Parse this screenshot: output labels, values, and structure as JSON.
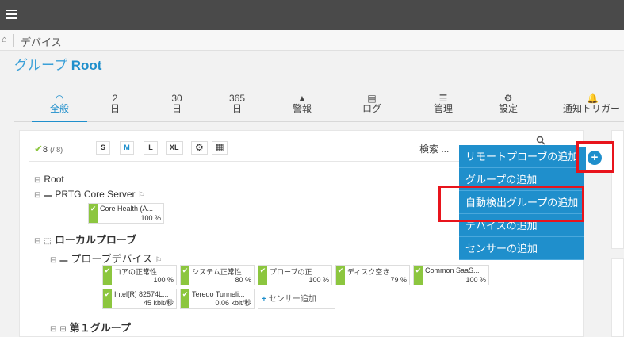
{
  "breadcrumb": {
    "item": "デバイス"
  },
  "title": {
    "prefix": "グループ",
    "name": "Root"
  },
  "tabs": [
    {
      "icon": "◠",
      "label": "全般"
    },
    {
      "icon": "2",
      "label": "日"
    },
    {
      "icon": "30",
      "label": "日"
    },
    {
      "icon": "365",
      "label": "日"
    },
    {
      "icon": "▲",
      "label": "警報"
    },
    {
      "icon": "▤",
      "label": "ログ"
    },
    {
      "icon": "☰",
      "label": "管理"
    },
    {
      "icon": "⚙",
      "label": "設定"
    },
    {
      "icon": "🔔",
      "label": "通知トリガー"
    }
  ],
  "toolbar": {
    "count": "8",
    "count_total": "(/ 8)",
    "sizes": [
      "S",
      "M",
      "L",
      "XL"
    ],
    "search_label": "検索 ..."
  },
  "tree": {
    "root": "Root",
    "core_server": "PRTG Core Server",
    "local_probe": "ローカルプローブ",
    "probe_device": "プローブデバイス",
    "group1": "第１グループ"
  },
  "sensors_core": [
    {
      "name": "Core Health (A...",
      "value": "100 %"
    }
  ],
  "sensors_probe": [
    {
      "name": "コアの正常性",
      "value": "100 %"
    },
    {
      "name": "システム正常性",
      "value": "80 %"
    },
    {
      "name": "プローブの正...",
      "value": "100 %"
    },
    {
      "name": "ディスク空き...",
      "value": "79 %"
    },
    {
      "name": "Common SaaS...",
      "value": "100 %"
    },
    {
      "name": "Intel[R] 82574L...",
      "value": "45 kbit/秒"
    },
    {
      "name": "Teredo Tunneli...",
      "value": "0.06 kbit/秒"
    }
  ],
  "add_sensor_label": "センサー追加",
  "menu": [
    "リモートプローブの追加",
    "グループの追加",
    "自動検出グループの追加",
    "デバイスの追加",
    "センサーの追加"
  ],
  "colors": {
    "accent": "#1f8fcc",
    "ok": "#8cc63f",
    "highlight": "#e8141c"
  }
}
